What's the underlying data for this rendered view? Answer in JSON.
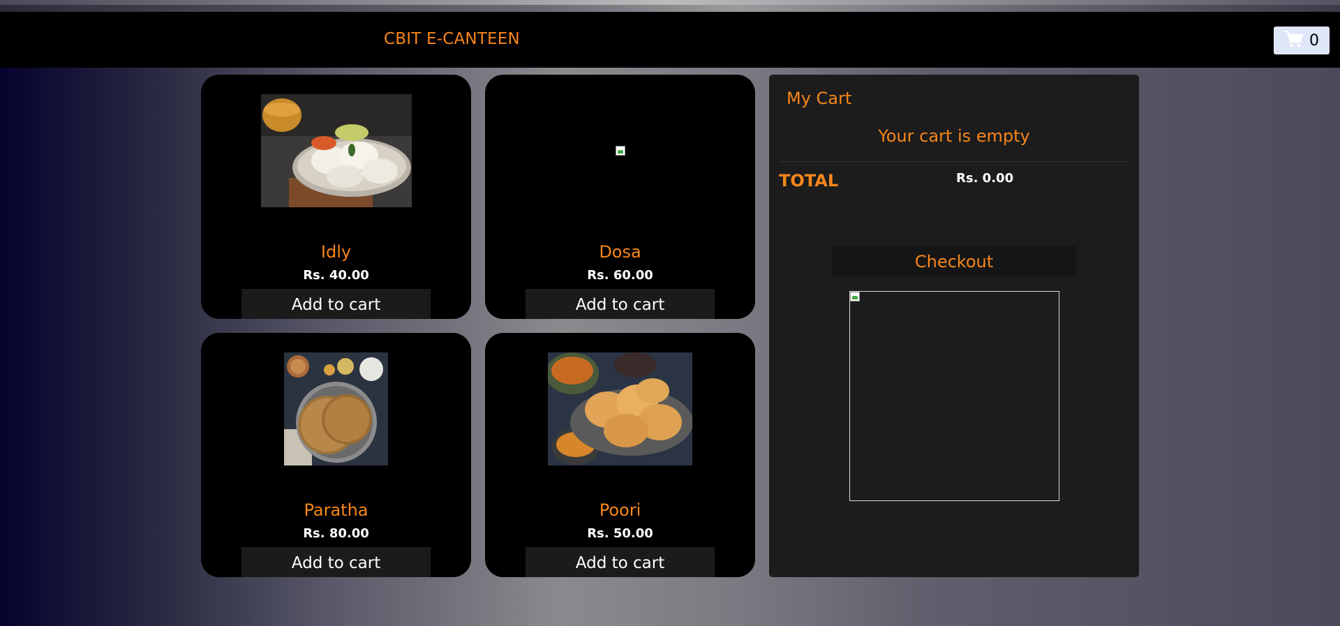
{
  "header": {
    "brand": "CBIT E-CANTEEN",
    "cart_icon": "shopping-cart-icon",
    "cart_count": "0"
  },
  "products": [
    {
      "name": "Idly",
      "price": "Rs. 40.00",
      "button": "Add to cart"
    },
    {
      "name": "Dosa",
      "price": "Rs. 60.00",
      "button": "Add to cart"
    },
    {
      "name": "Paratha",
      "price": "Rs. 80.00",
      "button": "Add to cart"
    },
    {
      "name": "Poori",
      "price": "Rs. 50.00",
      "button": "Add to cart"
    }
  ],
  "cart": {
    "title": "My Cart",
    "empty_message": "Your cart is empty",
    "total_label": "TOTAL",
    "total_value": "Rs. 0.00",
    "checkout_label": "Checkout"
  },
  "colors": {
    "accent": "#f7861c",
    "panel": "#1c1c1c",
    "navbar": "#000000"
  }
}
